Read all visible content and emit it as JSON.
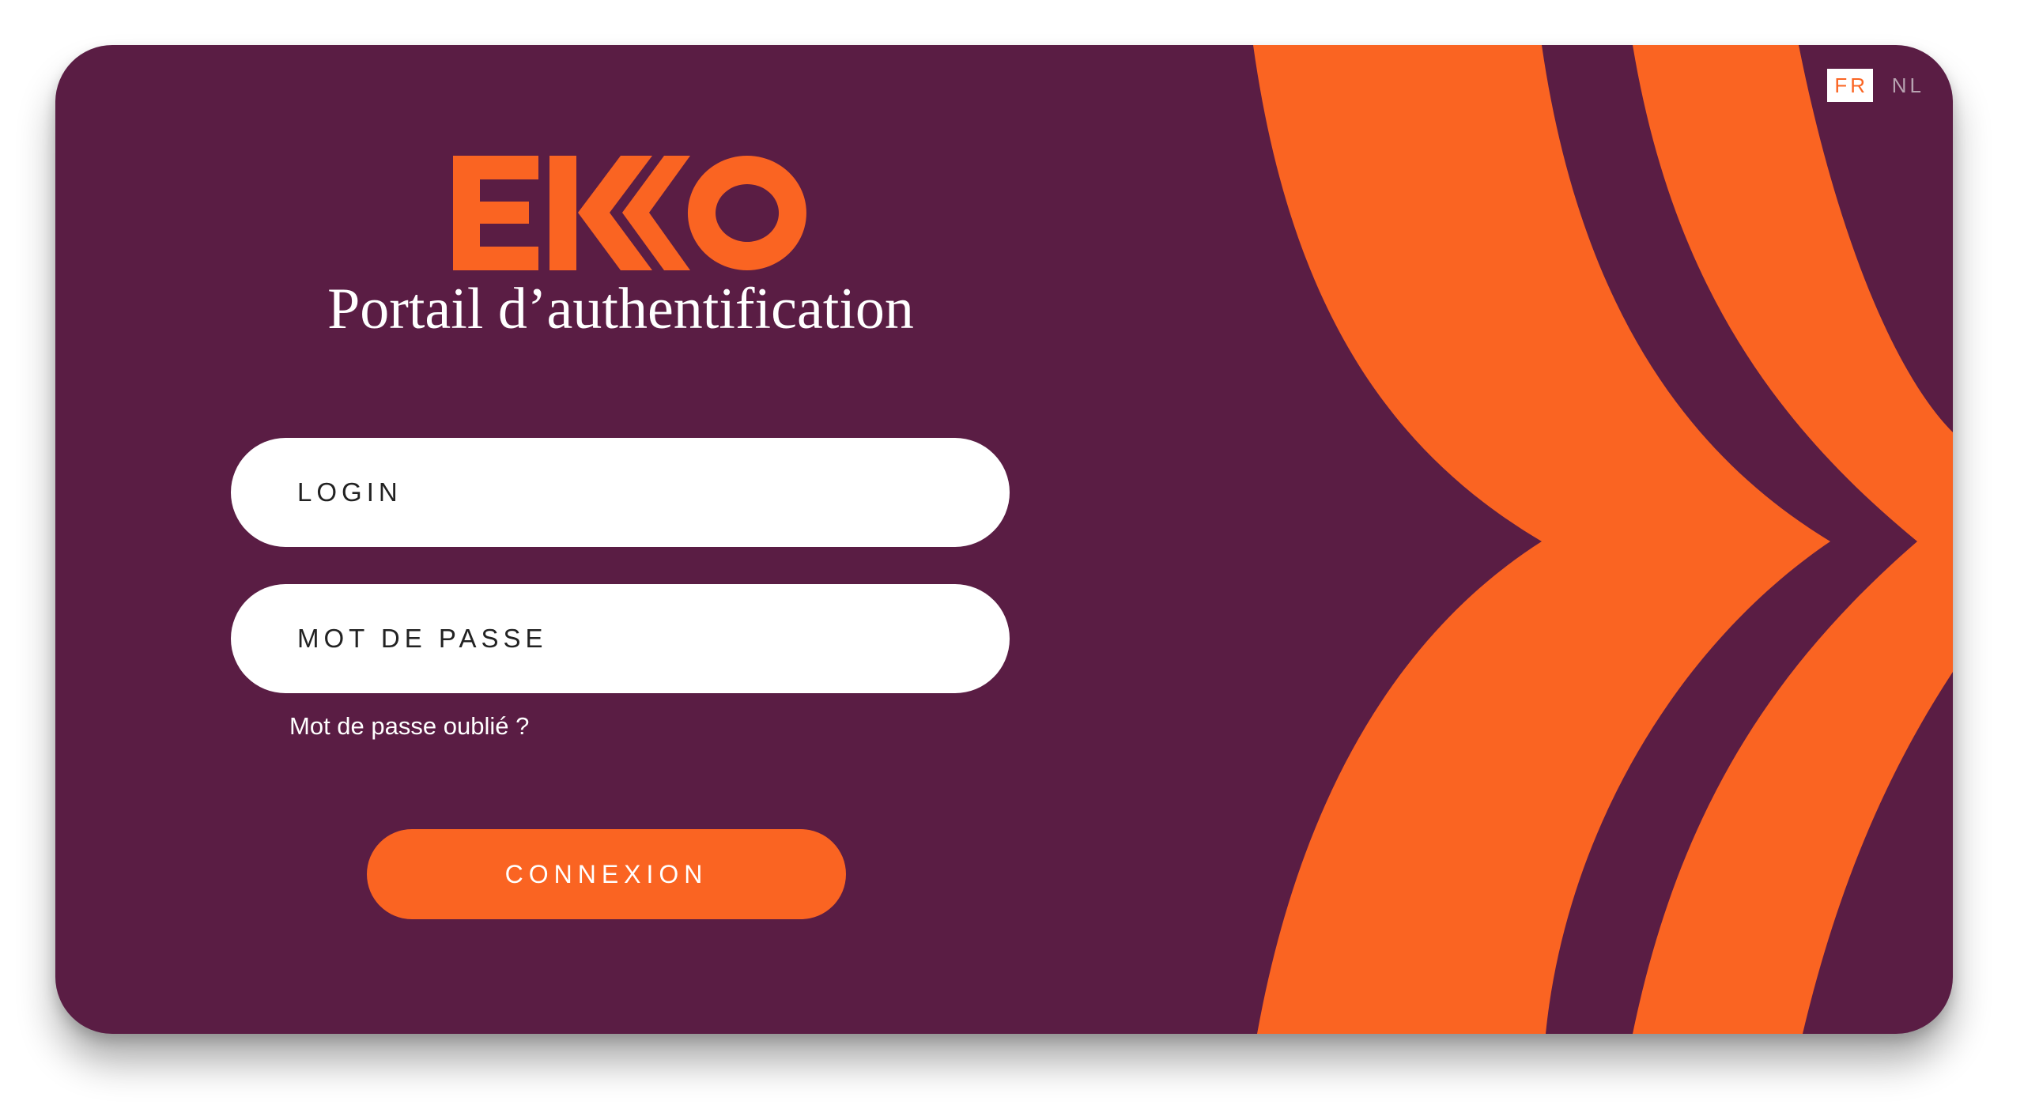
{
  "brand": {
    "name": "EKKO",
    "accent_color": "#fa6422",
    "background_color": "#5a1d44"
  },
  "header": {
    "subtitle": "Portail d’authentification"
  },
  "language": {
    "options": [
      "FR",
      "NL"
    ],
    "selected": "FR"
  },
  "form": {
    "login_placeholder": "LOGIN",
    "password_placeholder": "MOT DE PASSE",
    "forgot_password": "Mot de passe oublié ?",
    "submit_label": "CONNEXION"
  },
  "icons": {
    "decor": "chevron-arcs",
    "logo": "ekko-logo"
  }
}
